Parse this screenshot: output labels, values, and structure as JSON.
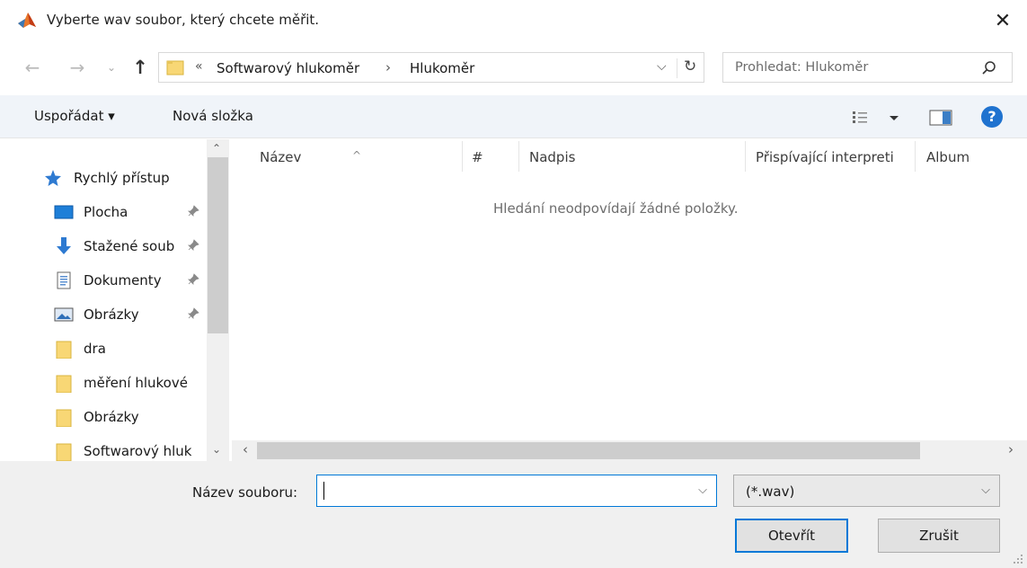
{
  "window": {
    "title": "Vyberte wav soubor, který chcete měřit.",
    "close_icon": "close-icon"
  },
  "nav": {
    "breadcrumb_prefix": "«",
    "breadcrumbs": [
      "Softwarový hlukoměr",
      "Hlukoměr"
    ],
    "breadcrumb_separator": "›",
    "search_placeholder": "Prohledat: Hlukoměr"
  },
  "toolbar": {
    "organize_label": "Uspořádat ▾",
    "new_folder_label": "Nová složka",
    "help_label": "?"
  },
  "sidebar": {
    "items": [
      {
        "label": "Rychlý přístup",
        "icon": "star-icon",
        "pinned": false
      },
      {
        "label": "Plocha",
        "icon": "desktop-icon",
        "pinned": true
      },
      {
        "label": "Stažené soub",
        "icon": "download-icon",
        "pinned": true
      },
      {
        "label": "Dokumenty",
        "icon": "documents-icon",
        "pinned": true
      },
      {
        "label": "Obrázky",
        "icon": "pictures-icon",
        "pinned": true
      },
      {
        "label": "dra",
        "icon": "folder-icon",
        "pinned": false
      },
      {
        "label": "měření hlukové",
        "icon": "folder-icon",
        "pinned": false
      },
      {
        "label": "Obrázky",
        "icon": "folder-icon",
        "pinned": false
      },
      {
        "label": "Softwarový hluk",
        "icon": "folder-icon",
        "pinned": false
      }
    ]
  },
  "columns": [
    "Název",
    "#",
    "Nadpis",
    "Přispívající interpreti",
    "Album"
  ],
  "empty_message": "Hledání neodpovídají žádné položky.",
  "footer": {
    "filename_label": "Název souboru:",
    "filename_value": "",
    "filter_value": "(*.wav)",
    "open_label": "Otevřít",
    "cancel_label": "Zrušit"
  },
  "colors": {
    "accent": "#0078d7",
    "folder": "#f8d775",
    "toolbar_bg": "#f0f4f9"
  }
}
